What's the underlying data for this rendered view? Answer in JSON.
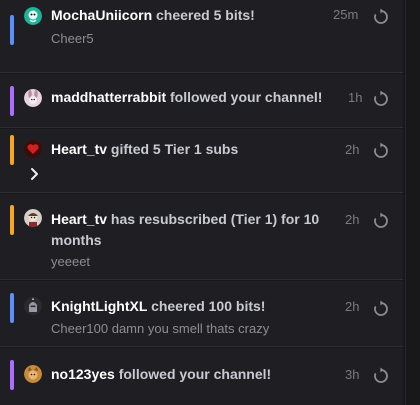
{
  "colors": {
    "bits": "#5b8ff9",
    "follow": "#a970ff",
    "subs": "#f5a623"
  },
  "events": [
    {
      "username": "MochaUniicorn",
      "action": "cheered 5 bits!",
      "message": "Cheer5",
      "time": "25m",
      "type": "bits",
      "avatar_icon": "unicorn-avatar-icon"
    },
    {
      "username": "maddhatterrabbit",
      "action": "followed your channel!",
      "time": "1h",
      "type": "follow",
      "avatar_icon": "rabbit-avatar-icon"
    },
    {
      "username": "Heart_tv",
      "action": "gifted 5 Tier 1 subs",
      "time": "2h",
      "type": "subs",
      "avatar_icon": "heart-avatar-icon"
    },
    {
      "username": "Heart_tv",
      "action": "has resubscribed (Tier 1) for 10 months",
      "message": "yeeeet",
      "time": "2h",
      "type": "subs",
      "avatar_icon": "character-avatar-icon"
    },
    {
      "username": "KnightLightXL",
      "action": "cheered 100 bits!",
      "message": "Cheer100 damn you smell thats crazy",
      "time": "2h",
      "type": "bits",
      "avatar_icon": "knight-avatar-icon"
    },
    {
      "username": "no123yes",
      "action": "followed your channel!",
      "time": "3h",
      "type": "follow",
      "avatar_icon": "cat-avatar-icon"
    }
  ]
}
